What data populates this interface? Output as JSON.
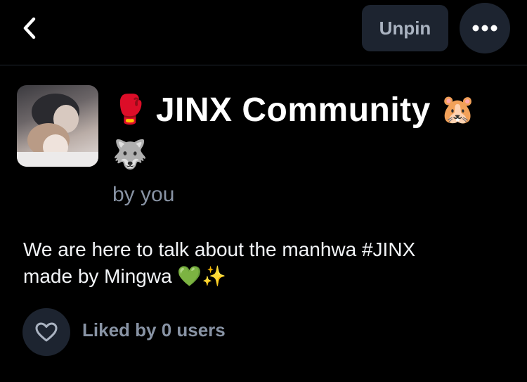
{
  "header": {
    "back_icon": "chevron-left-icon",
    "unpin_label": "Unpin",
    "more_icon": "more-horizontal-icon"
  },
  "community": {
    "title_prefix_emoji": "🥊",
    "title": "JINX Community",
    "title_suffix_emoji": "🐹",
    "title_second_line_emoji": "🐺",
    "byline": "by you",
    "description_line1": "We are here to talk about the manhwa #JINX",
    "description_line2": "made by Mingwa 💚✨"
  },
  "likes": {
    "icon": "heart-icon",
    "label": "Liked by 0 users"
  },
  "colors": {
    "background": "#000000",
    "button_bg": "#1d2430",
    "muted_text": "#8893a4"
  }
}
